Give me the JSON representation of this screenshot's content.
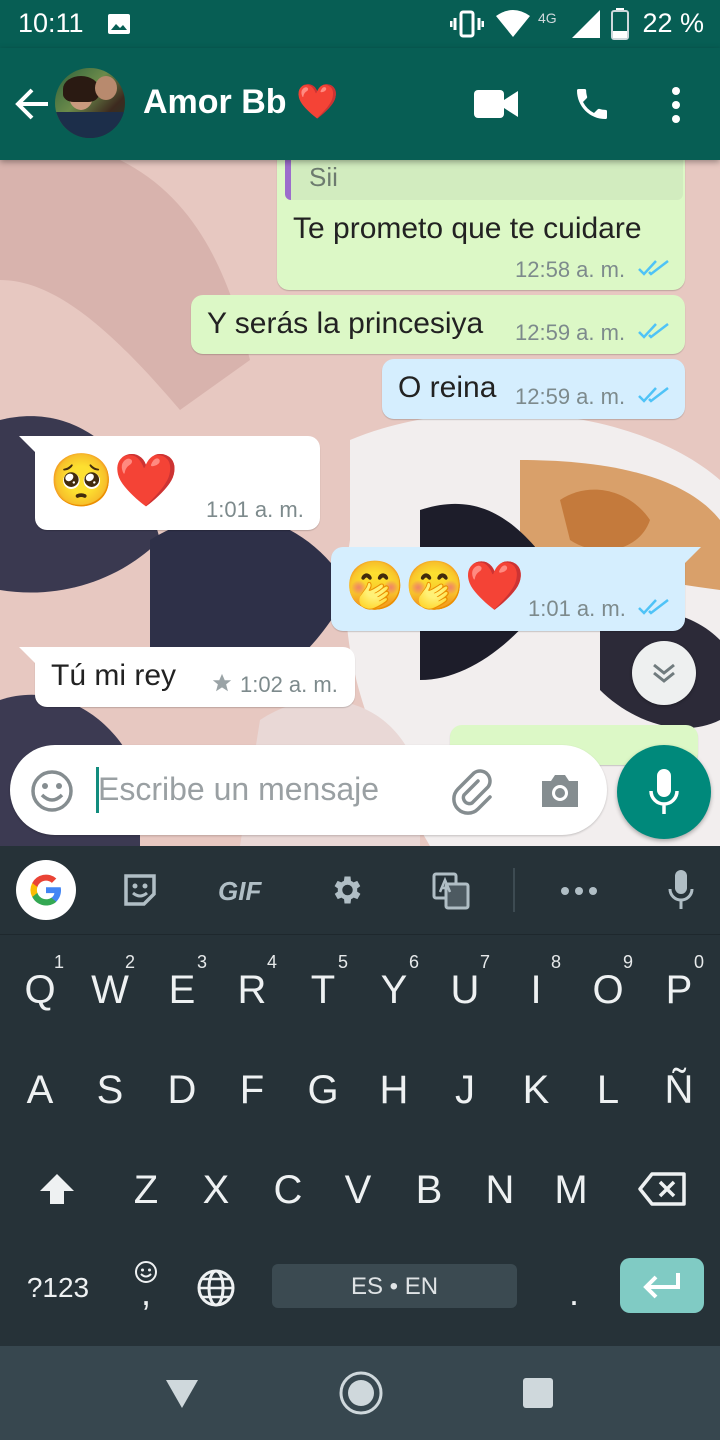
{
  "status_bar": {
    "time": "10:11",
    "battery_pct": "22 %",
    "network": "4G"
  },
  "app_bar": {
    "contact_name": "Amor Bb ❤️"
  },
  "messages": [
    {
      "quoted": "Sii",
      "text": "Te prometo que te cuidare",
      "time": "12:58 a. m.",
      "direction": "out"
    },
    {
      "text": "Y serás la princesiya",
      "time": "12:59 a. m.",
      "direction": "out"
    },
    {
      "text": "O reina",
      "time": "12:59 a. m.",
      "direction": "out"
    },
    {
      "text": "🥺❤️",
      "time": "1:01 a. m.",
      "direction": "in"
    },
    {
      "text": "🤭🤭❤️",
      "time": "1:01 a. m.",
      "direction": "out"
    },
    {
      "text": "Tú mi rey",
      "time": "1:02 a. m.",
      "direction": "in",
      "starred": true
    }
  ],
  "composer": {
    "placeholder": "Escribe un mensaje"
  },
  "keyboard": {
    "toolbar": {
      "gif": "GIF"
    },
    "row1": [
      "Q",
      "W",
      "E",
      "R",
      "T",
      "Y",
      "U",
      "I",
      "O",
      "P"
    ],
    "row1_hints": [
      "1",
      "2",
      "3",
      "4",
      "5",
      "6",
      "7",
      "8",
      "9",
      "0"
    ],
    "row2": [
      "A",
      "S",
      "D",
      "F",
      "G",
      "H",
      "J",
      "K",
      "L",
      "Ñ"
    ],
    "row3": [
      "Z",
      "X",
      "C",
      "V",
      "B",
      "N",
      "M"
    ],
    "symbols_key": "?123",
    "comma_key": ",",
    "space_label": "ES • EN",
    "period_key": "."
  },
  "colors": {
    "header": "#075e54",
    "outgoing": "#dcf8c6",
    "incoming": "#ffffff",
    "accent": "#00897b",
    "tick": "#4fc3f7"
  }
}
